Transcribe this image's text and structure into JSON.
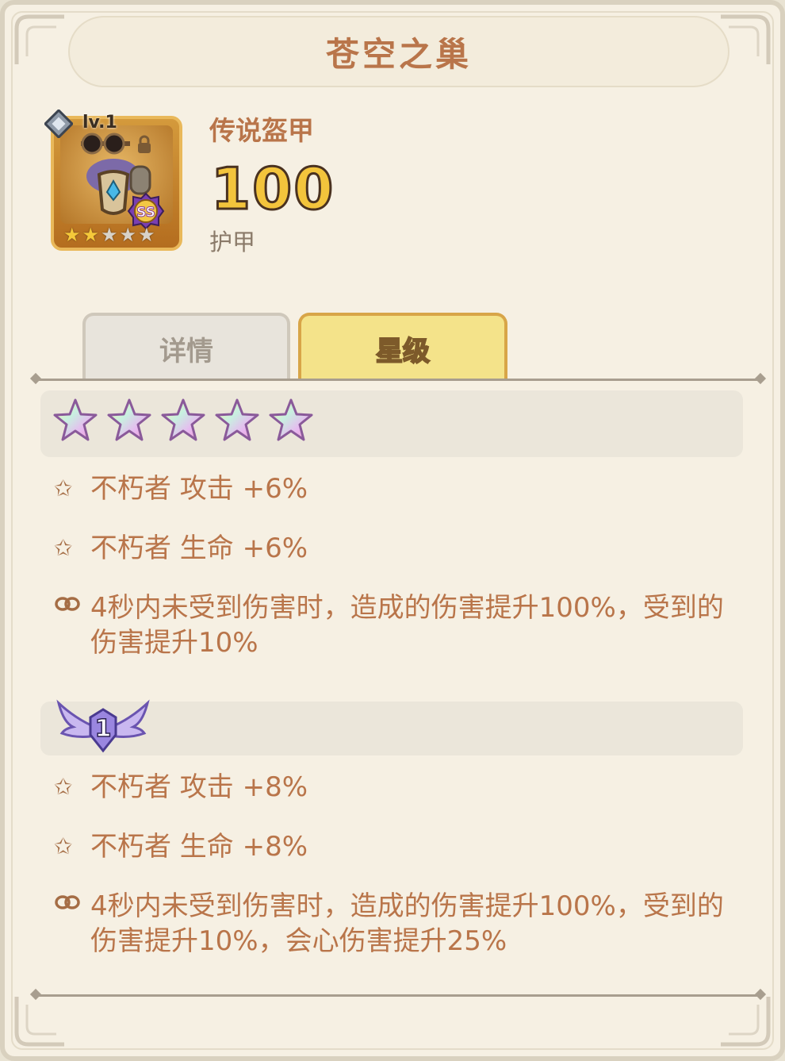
{
  "title": "苍空之巢",
  "item": {
    "level": "lv.1",
    "grade": "SS",
    "card_stars_filled": 2,
    "card_stars_total": 5,
    "type": "传说盔甲",
    "value": "100",
    "stat": "护甲"
  },
  "tabs": [
    {
      "label": "详情",
      "active": false
    },
    {
      "label": "星级",
      "active": true
    }
  ],
  "tiers": [
    {
      "header": "five_stars",
      "star_count": 5,
      "lines": [
        {
          "icon": "star-icon",
          "text": "不朽者 攻击 +6%"
        },
        {
          "icon": "star-icon",
          "text": "不朽者 生命 +6%"
        },
        {
          "icon": "link-icon",
          "text": "4秒内未受到伤害时，造成的伤害提升100%，受到的伤害提升10%"
        }
      ]
    },
    {
      "header": "wing_badge",
      "badge_number": "1",
      "lines": [
        {
          "icon": "star-icon",
          "text": "不朽者 攻击 +8%"
        },
        {
          "icon": "star-icon",
          "text": "不朽者 生命 +8%"
        },
        {
          "icon": "link-icon",
          "text": "4秒内未受到伤害时，造成的伤害提升100%，受到的伤害提升10%，会心伤害提升25%"
        }
      ]
    }
  ],
  "colors": {
    "accent_text": "#b9754a",
    "value_gold": "#f3c43c",
    "active_tab": "#f4e38a",
    "panel_bg": "#f6f0e3"
  }
}
